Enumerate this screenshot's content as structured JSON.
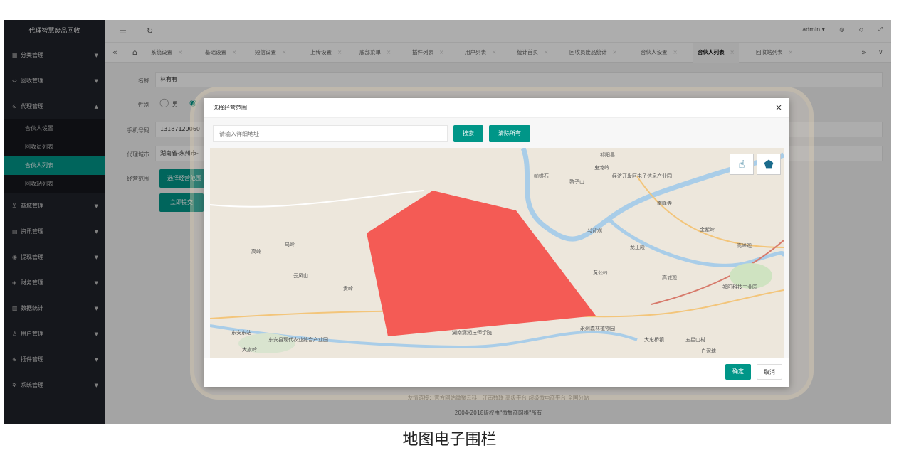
{
  "app": {
    "brand": "代理智慧废品回收"
  },
  "sidebar": {
    "items": [
      {
        "label": "分类管理",
        "icon": "grid-icon",
        "glyph": "▦"
      },
      {
        "label": "回收管理",
        "icon": "link-icon",
        "glyph": "⇔"
      },
      {
        "label": "代理管理",
        "icon": "gear-icon",
        "glyph": "⊙"
      },
      {
        "label": "商城管理",
        "icon": "cart-icon",
        "glyph": "⊻"
      },
      {
        "label": "资讯管理",
        "icon": "news-icon",
        "glyph": "▤"
      },
      {
        "label": "提现管理",
        "icon": "withdraw-icon",
        "glyph": "◉"
      },
      {
        "label": "财务管理",
        "icon": "finance-icon",
        "glyph": "◈"
      },
      {
        "label": "数据统计",
        "icon": "chart-icon",
        "glyph": "▥"
      },
      {
        "label": "用户管理",
        "icon": "user-icon",
        "glyph": "♙"
      },
      {
        "label": "插件管理",
        "icon": "plugin-icon",
        "glyph": "⊕"
      },
      {
        "label": "系统管理",
        "icon": "settings-icon",
        "glyph": "✲"
      }
    ],
    "sub_items": [
      {
        "label": "合伙人设置"
      },
      {
        "label": "回收员列表"
      },
      {
        "label": "合伙人列表"
      },
      {
        "label": "回收站列表"
      }
    ]
  },
  "topbar": {
    "user": "admin ▾",
    "icons": [
      "◎",
      "◇",
      "⤢"
    ]
  },
  "tabs": [
    {
      "label": "系统设置"
    },
    {
      "label": "基础设置"
    },
    {
      "label": "短信设置"
    },
    {
      "label": "上传设置"
    },
    {
      "label": "底部菜单"
    },
    {
      "label": "插件列表"
    },
    {
      "label": "用户列表"
    },
    {
      "label": "统计首页"
    },
    {
      "label": "回收员废品统计"
    },
    {
      "label": "合伙人设置"
    },
    {
      "label": "合伙人列表"
    },
    {
      "label": "回收站列表"
    }
  ],
  "form": {
    "name_label": "名称",
    "name_value": "林有有",
    "gender_label": "性别",
    "gender_male": "男",
    "phone_label": "手机号码",
    "phone_value": "13187129060",
    "city_label": "代理城市",
    "city_value": "湖南省-永州市-",
    "range_label": "经营范围",
    "range_button": "选择经营范围",
    "submit": "立即提交"
  },
  "footer": {
    "links": "友情链接：官方网站微聚云科　江南数联 高级平台 超级微电商平台 全国分站",
    "copyright": "2004-2018版权由\"微聚商网络\"所有"
  },
  "modal": {
    "title": "选择经营范围",
    "search_placeholder": "请输入详细地址",
    "search_button": "搜索",
    "clear_button": "清除所有",
    "confirm": "确定",
    "cancel": "取消",
    "tools": [
      {
        "icon": "hand-pointer-icon",
        "glyph": "☝"
      },
      {
        "icon": "polygon-icon",
        "glyph": "⬟"
      }
    ]
  },
  "map": {
    "fence_color": "#f45b55",
    "labels": [
      "祁阳县",
      "鬼龙岭",
      "经济开发区电子信息产业园",
      "黎子山",
      "帕蝶石",
      "南峰寺",
      "金紫岭",
      "马背观",
      "龙王殿",
      "黄公岭",
      "高城观",
      "祁阳科技工业园",
      "永州森林植物园",
      "湖南潇湘技师学院",
      "大忠桥镇",
      "云风山",
      "贵岭",
      "乌岭",
      "高岭",
      "东安东站",
      "东安县现代农业综合产业园",
      "大旗岭",
      "五星山村",
      "高峰观",
      "白泥塘"
    ]
  },
  "caption": "地图电子围栏"
}
